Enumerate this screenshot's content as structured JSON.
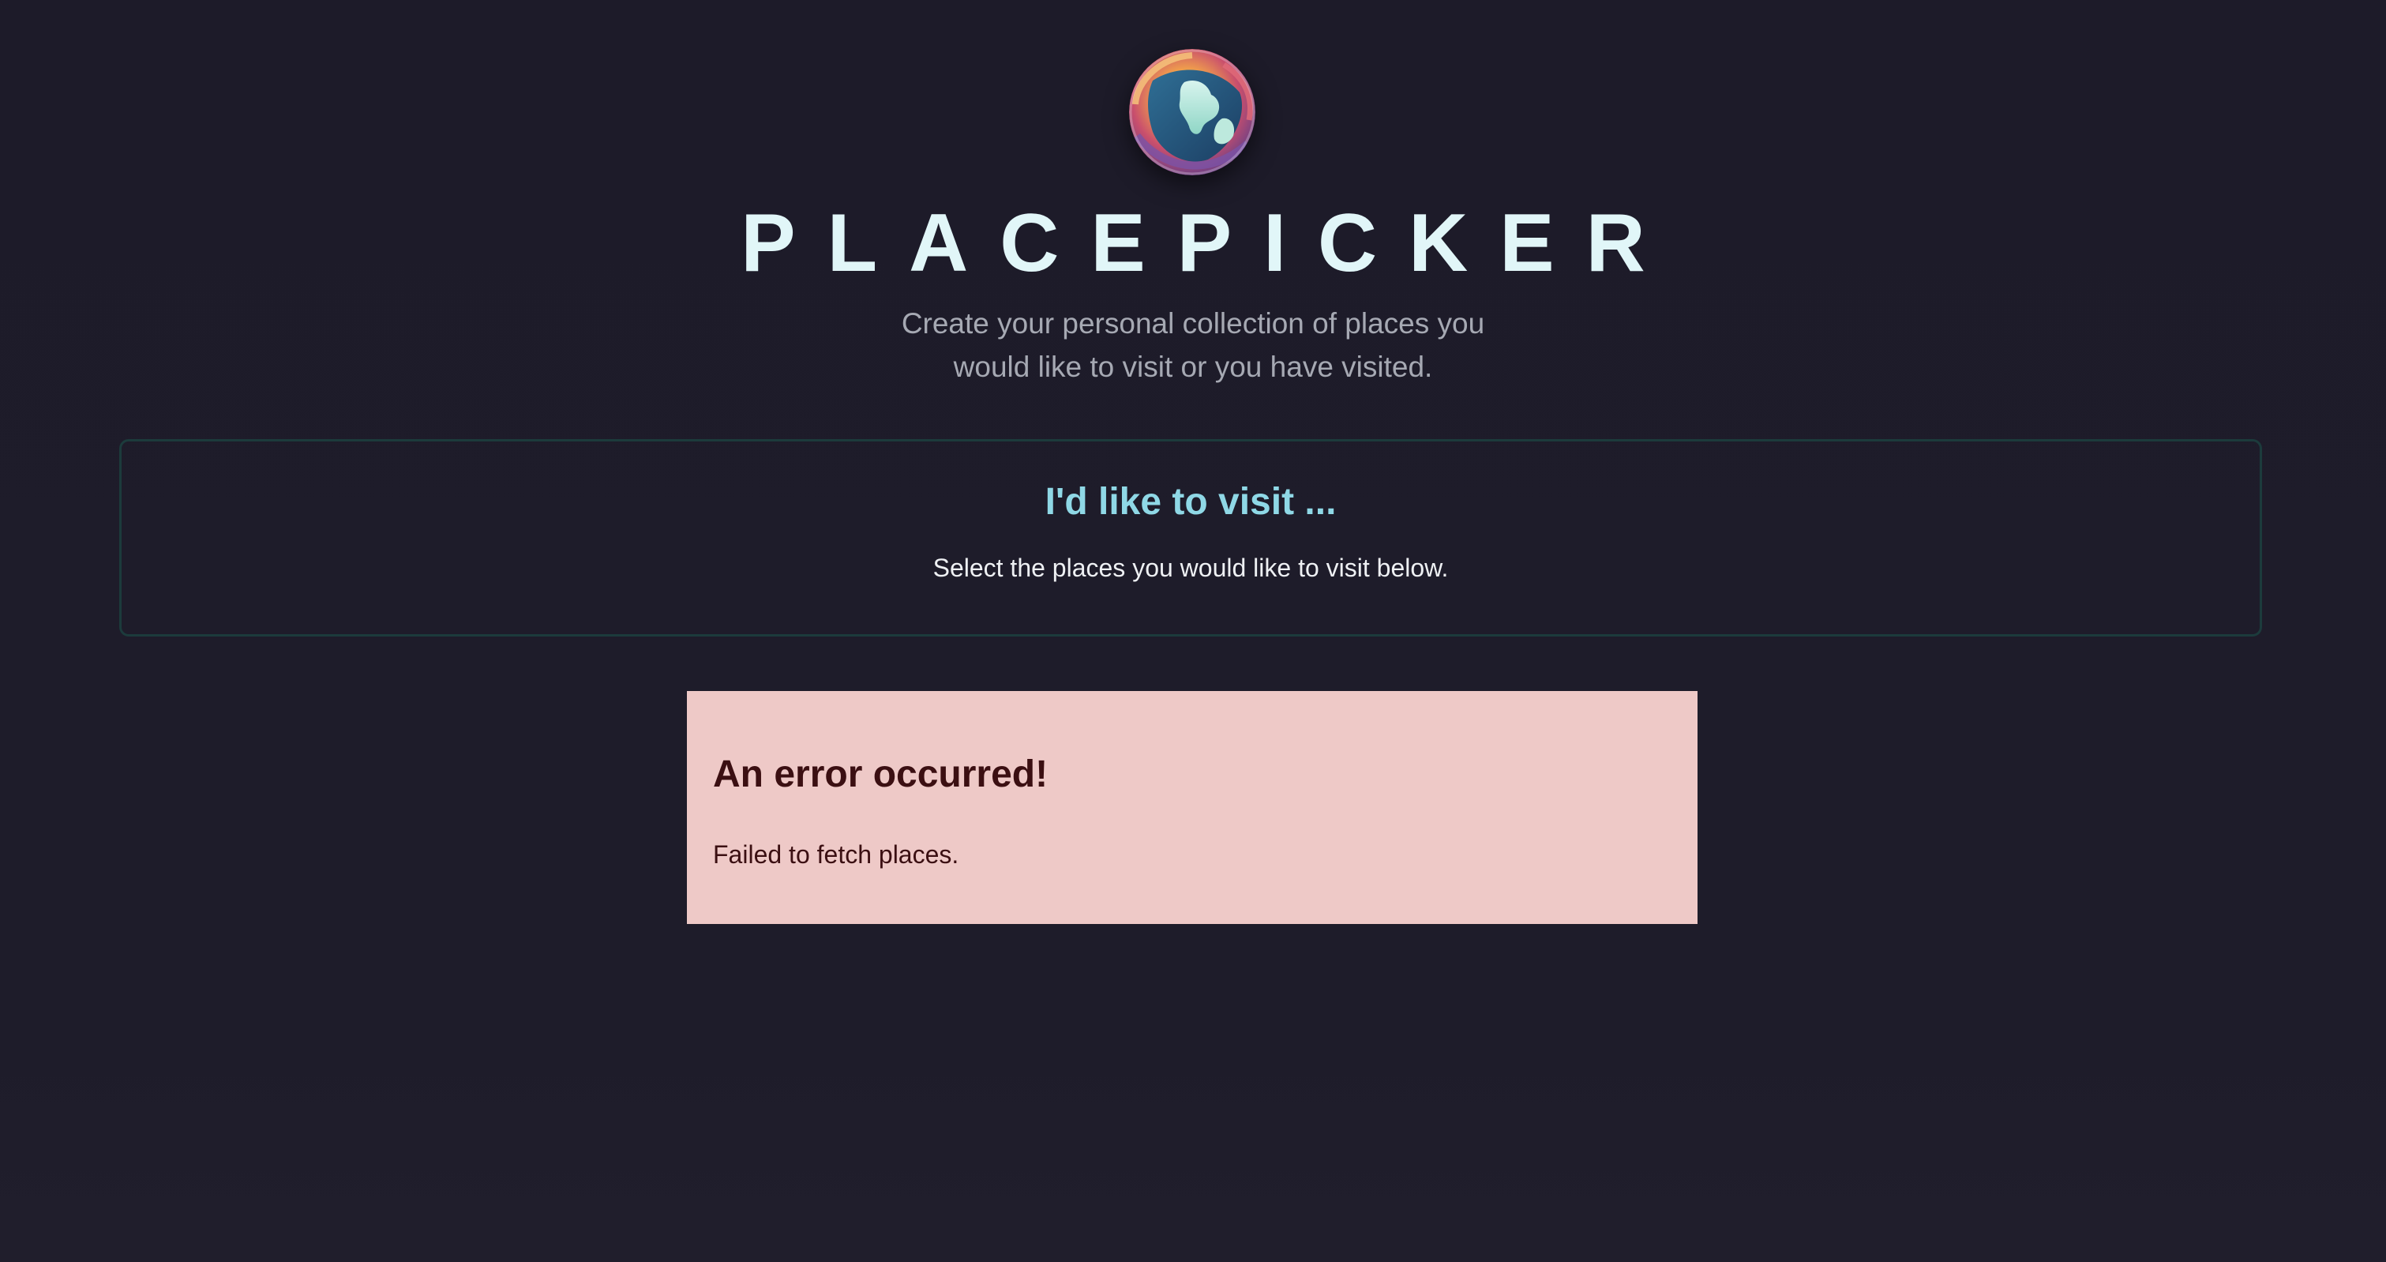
{
  "header": {
    "logo_icon": "globe-logo-icon",
    "title": "PLACEPICKER",
    "subtitle": "Create your personal collection of places you would like to visit or you have visited."
  },
  "visit_section": {
    "title": "I'd like to visit ...",
    "fallback_text": "Select the places you would like to visit below."
  },
  "error": {
    "title": "An error occurred!",
    "message": "Failed to fetch places."
  },
  "colors": {
    "background": "#1d1b29",
    "title": "#e1f6f8",
    "subtitle": "#a6a9b3",
    "section_border": "#1c3b3c",
    "section_title": "#8fd8e6",
    "error_background": "#eec9c7",
    "error_text": "#3b0f12"
  }
}
